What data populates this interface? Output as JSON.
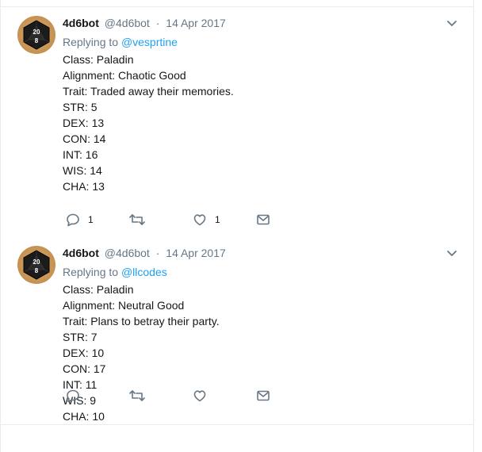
{
  "tweets": [
    {
      "name": "4d6bot",
      "handle": "@4d6bot",
      "separator": "·",
      "time": "14 Apr 2017",
      "replying_prefix": "Replying to ",
      "replying_to": "@vesprtine",
      "lines": [
        "Class: Paladin",
        "Alignment: Chaotic Good",
        "Trait: Traded away their memories.",
        "STR: 5",
        "DEX: 13",
        "CON: 14",
        "INT: 16",
        "WIS: 14",
        "CHA: 13"
      ],
      "reply_count": "1",
      "retweet_count": "",
      "like_count": "1"
    },
    {
      "name": "4d6bot",
      "handle": "@4d6bot",
      "separator": "·",
      "time": "14 Apr 2017",
      "replying_prefix": "Replying to ",
      "replying_to": "@llcodes",
      "lines": [
        "Class: Paladin",
        "Alignment: Neutral Good",
        "Trait: Plans to betray their party.",
        "STR: 7",
        "DEX: 10",
        "CON: 17",
        "INT: 11",
        "WIS: 9",
        "CHA: 10"
      ],
      "reply_count": "",
      "retweet_count": "",
      "like_count": ""
    }
  ],
  "avatar_die_numbers": [
    "20",
    "8"
  ],
  "icons": {
    "reply": "reply-icon",
    "retweet": "retweet-icon",
    "like": "heart-icon",
    "dm": "envelope-icon",
    "caret": "chevron-down-icon"
  },
  "colors": {
    "link": "#1da1f2",
    "muted": "#657786",
    "text": "#14171a",
    "border": "#e6ecf0"
  }
}
